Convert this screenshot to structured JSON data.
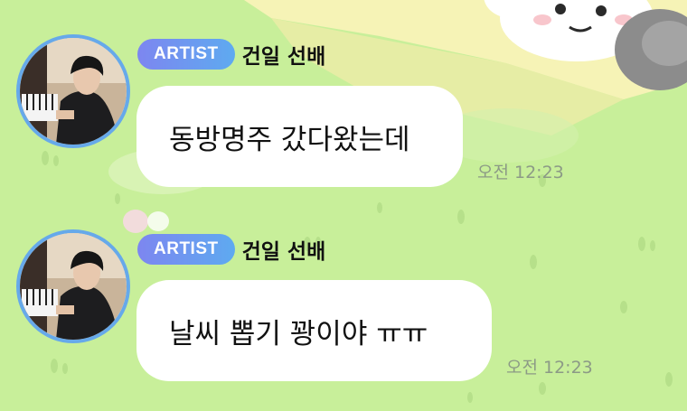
{
  "messages": [
    {
      "badge": "ARTIST",
      "sender": "건일 선배",
      "text": "동방명주 갔다왔는데",
      "time": "오전 12:23"
    },
    {
      "badge": "ARTIST",
      "sender": "건일 선배",
      "text": "날씨 뽑기 꽝이야 ㅠㅠ",
      "time": "오전 12:23"
    }
  ],
  "colors": {
    "background": "#c8ef9a",
    "badge_gradient_start": "#7d86f0",
    "badge_gradient_end": "#5eaaf0",
    "avatar_ring": "#66a9ea",
    "bubble": "#ffffff",
    "timestamp": "#8c9a86"
  },
  "icons": [
    "artist-avatar",
    "background-illustration"
  ]
}
